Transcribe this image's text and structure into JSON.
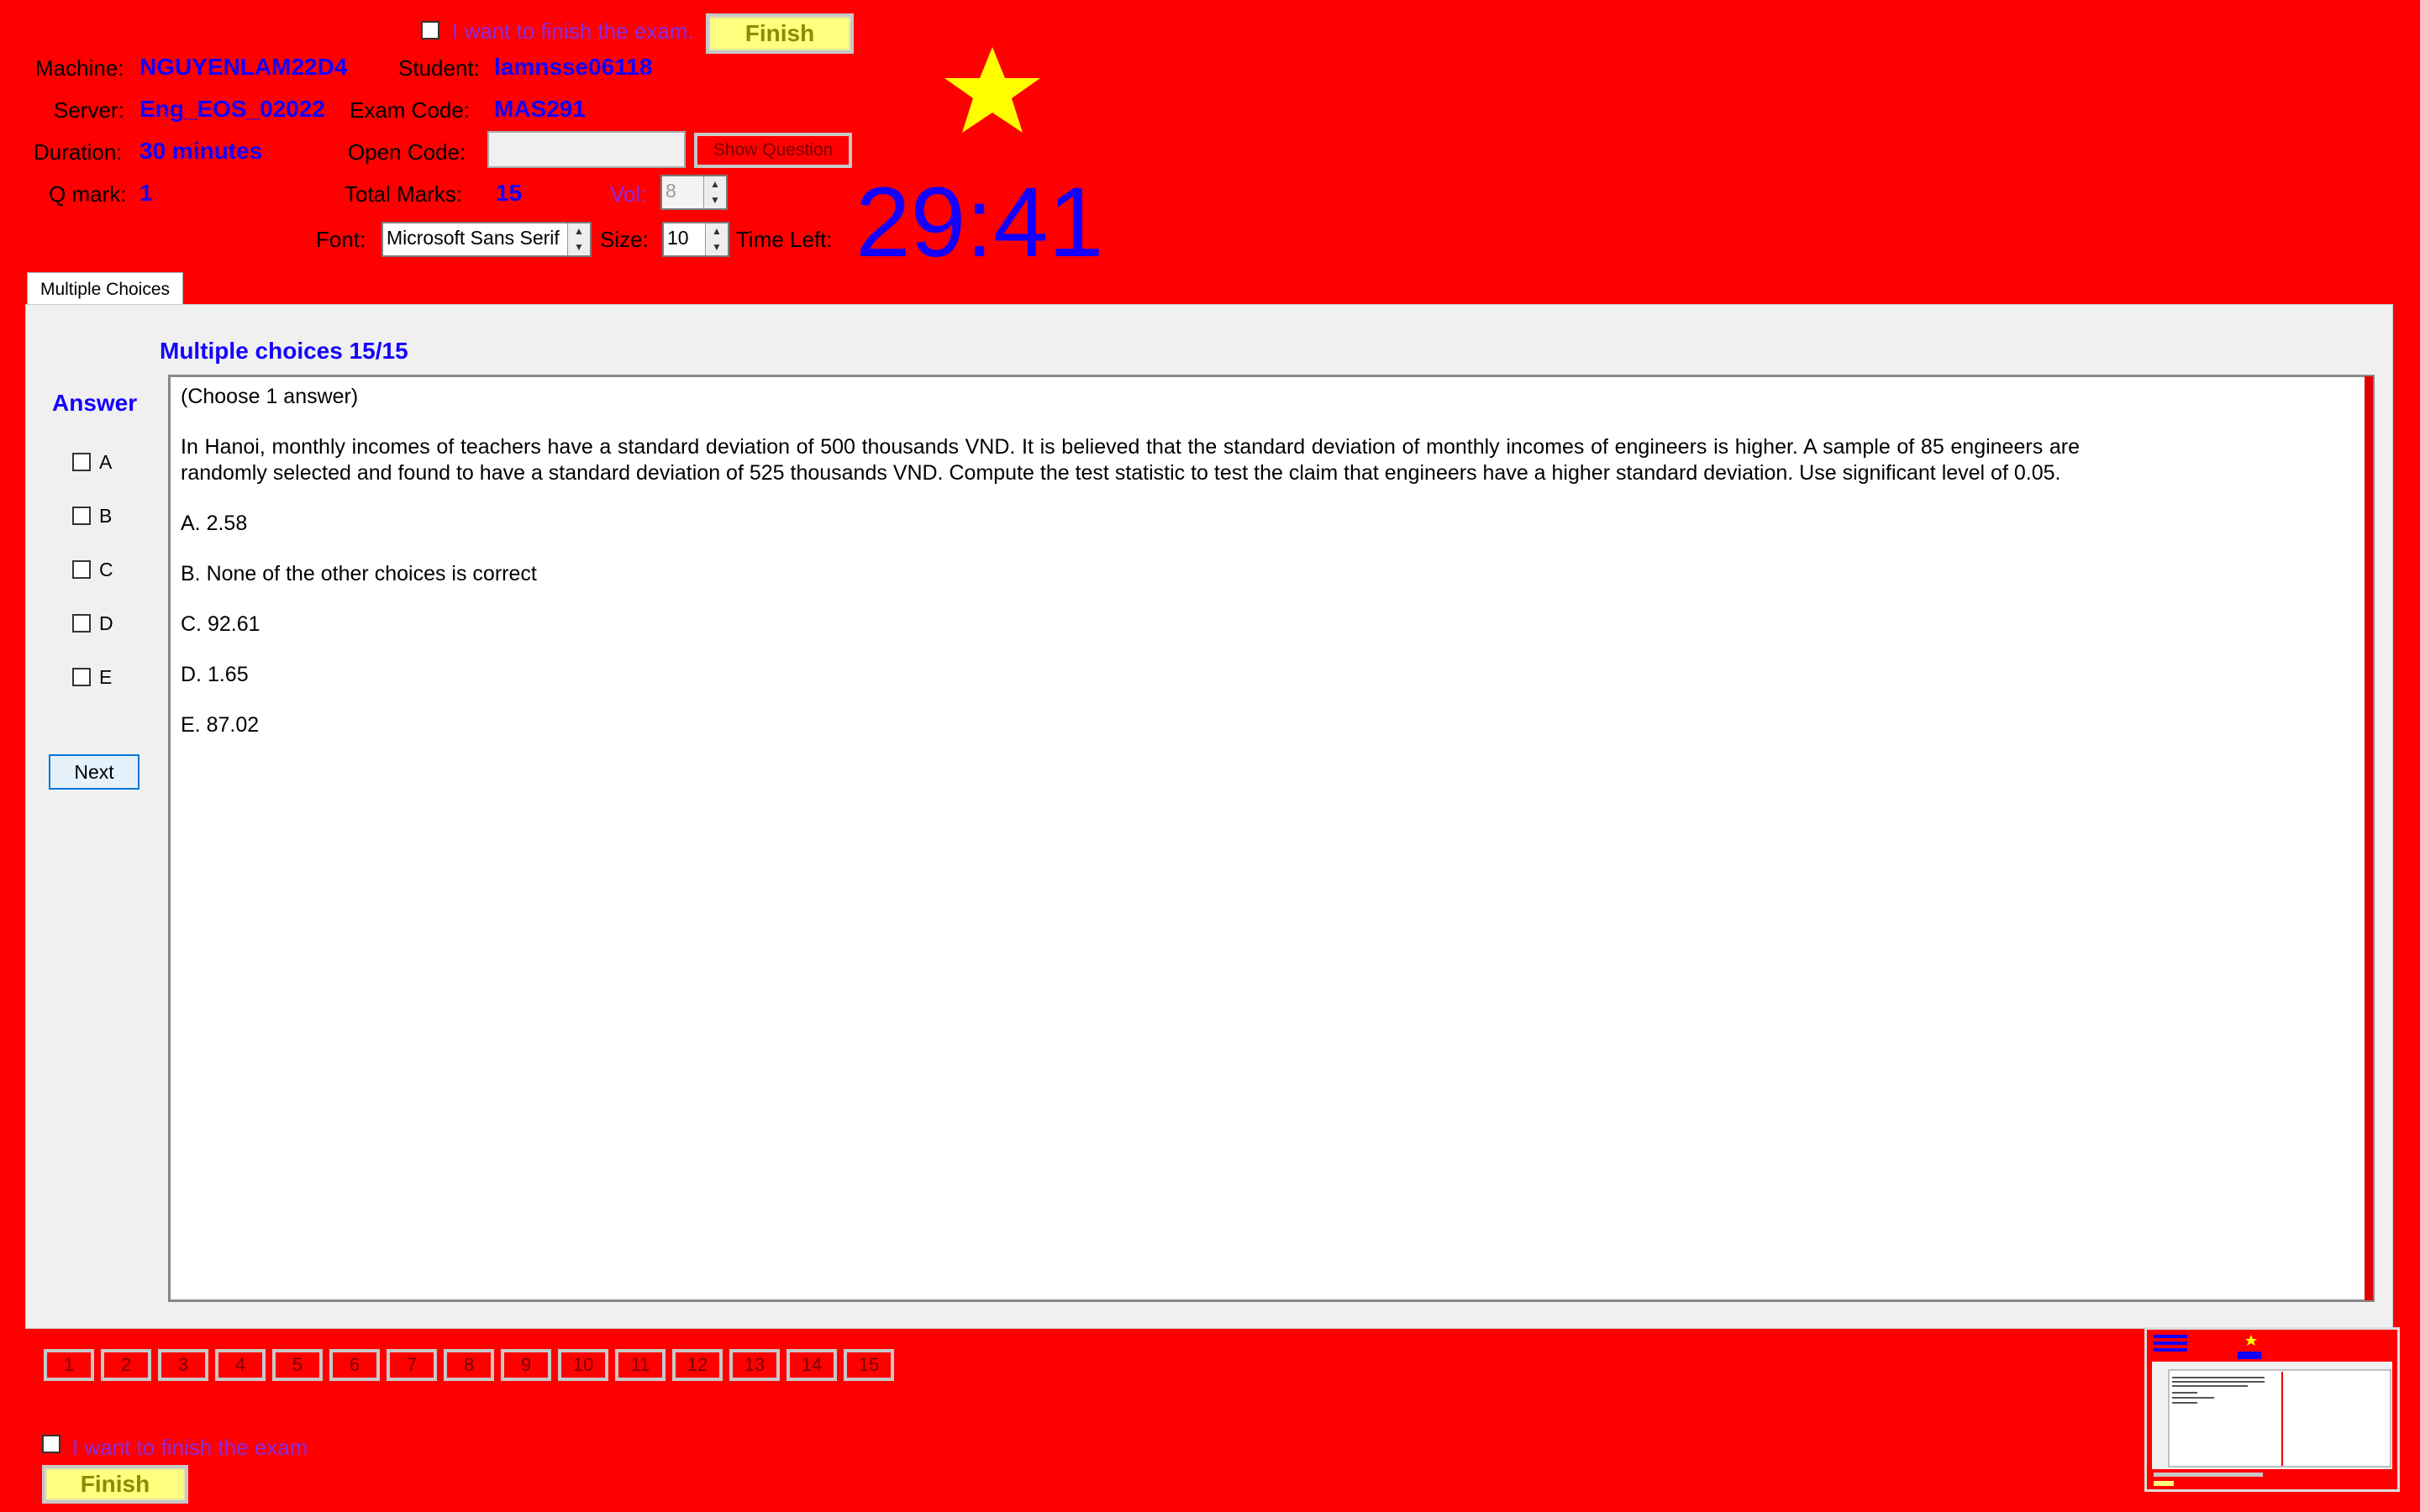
{
  "finish_checkbox_label": "I want to finish the exam.",
  "finish_label": "Finish",
  "header": {
    "machine_label": "Machine:",
    "machine": "NGUYENLAM22D4",
    "student_label": "Student:",
    "student": "lamnsse06118",
    "server_label": "Server:",
    "server": "Eng_EOS_02022",
    "exam_code_label": "Exam Code:",
    "exam_code": "MAS291",
    "duration_label": "Duration:",
    "duration": "30 minutes",
    "open_code_label": "Open Code:",
    "open_code_value": "",
    "show_question_label": "Show Question",
    "qmark_label": "Q mark:",
    "qmark": "1",
    "total_marks_label": "Total Marks:",
    "total_marks": "15",
    "vol_label": "Vol:",
    "vol": "8",
    "font_label": "Font:",
    "font_value": "Microsoft Sans Serif",
    "size_label": "Size:",
    "size_value": "10",
    "time_left_label": "Time Left:",
    "time_left": "29:41"
  },
  "tab": {
    "label": "Multiple Choices"
  },
  "question": {
    "title": "Multiple choices 15/15",
    "instruction": "(Choose 1 answer)",
    "body": "In Hanoi, monthly incomes of teachers have a standard deviation of 500 thousands VND. It is believed that the standard deviation of monthly incomes of engineers is higher. A sample of 85 engineers are randomly selected and found to have a standard deviation of 525 thousands VND. Compute the test statistic to test the claim that engineers have a higher standard deviation. Use significant level of 0.05.",
    "choices": [
      "A.  2.58",
      "B.  None of the other choices is correct",
      "C.  92.61",
      "D.  1.65",
      "E.  87.02"
    ]
  },
  "answer": {
    "label": "Answer",
    "options": [
      "A",
      "B",
      "C",
      "D",
      "E"
    ],
    "next_label": "Next"
  },
  "nav": [
    "1",
    "2",
    "3",
    "4",
    "5",
    "6",
    "7",
    "8",
    "9",
    "10",
    "11",
    "12",
    "13",
    "14",
    "15"
  ],
  "bottom": {
    "finish_checkbox_label": "I want to finish the exam",
    "finish_label": "Finish"
  },
  "colors": {
    "background": "#ff0000",
    "value_text": "#1400ff",
    "star": "#ffff00"
  }
}
